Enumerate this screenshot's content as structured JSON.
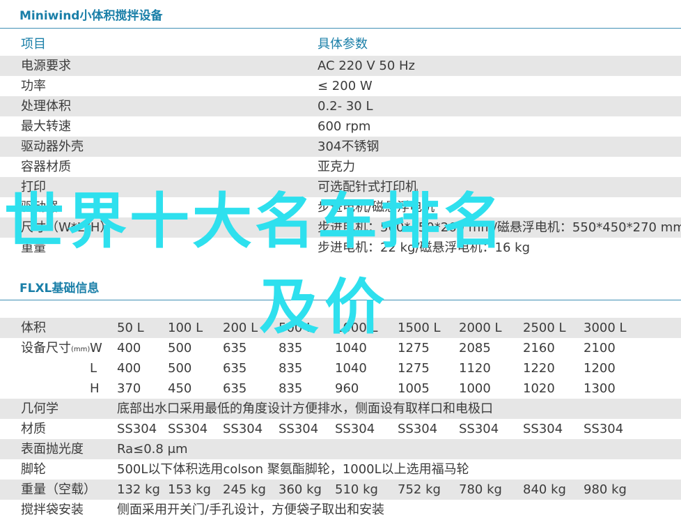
{
  "section1": {
    "title": "Miniwind小体积搅拌设备",
    "header": {
      "item": "项目",
      "param": "具体参数"
    },
    "rows": [
      {
        "item": "电源要求",
        "value": "AC 220 V 50 Hz"
      },
      {
        "item": "功率",
        "value": "≤ 200 W"
      },
      {
        "item": "处理体积",
        "value": "0.2- 30 L"
      },
      {
        "item": "最大转速",
        "value": "600 rpm"
      },
      {
        "item": "驱动器外壳",
        "value": "304不锈钢"
      },
      {
        "item": "容器材质",
        "value": "亚克力"
      },
      {
        "item": "打印",
        "value": "可选配针式打印机"
      },
      {
        "item": "驱动器",
        "value": "步进电机/磁悬浮电机"
      },
      {
        "item": "尺寸（W*L*H）",
        "value": "步进电机：560*450*260 mm/磁悬浮电机：550*450*270 mm"
      },
      {
        "item": "重量",
        "value": "步进电机：22 kg/磁悬浮电机：16 kg"
      }
    ]
  },
  "section2": {
    "title": "FLXL基础信息",
    "rows": [
      {
        "label": "体积",
        "values": [
          "50 L",
          "100 L",
          "200 L",
          "500 L",
          "1000 L",
          "1500 L",
          "2000 L",
          "2500 L",
          "3000 L"
        ]
      },
      {
        "label": "设备尺寸",
        "unit": "(mm)",
        "axis": "W",
        "values": [
          "400",
          "500",
          "635",
          "835",
          "1040",
          "1275",
          "2085",
          "2160",
          "2100"
        ]
      },
      {
        "axis": "L",
        "values": [
          "400",
          "500",
          "635",
          "835",
          "1040",
          "1275",
          "1120",
          "1220",
          "1200"
        ]
      },
      {
        "axis": "H",
        "values": [
          "370",
          "450",
          "635",
          "835",
          "960",
          "1005",
          "1000",
          "1020",
          "1300"
        ]
      },
      {
        "label": "几何学",
        "text": "底部出水口采用最低的角度设计方便排水，侧面设有取样口和电极口"
      },
      {
        "label": "材质",
        "values": [
          "SS304",
          "SS304",
          "SS304",
          "SS304",
          "SS304",
          "SS304",
          "SS304",
          "SS304",
          "SS304"
        ]
      },
      {
        "label": "表面抛光度",
        "text": "Ra≤0.8 μm"
      },
      {
        "label": "脚轮",
        "text": "500L以下体积选用colson 聚氨酯脚轮，1000L以上选用福马轮"
      },
      {
        "label": "重量（空载）",
        "values": [
          "132 kg",
          "153 kg",
          "245 kg",
          "360 kg",
          "510 kg",
          "752 kg",
          "780 kg",
          "840 kg",
          "980 kg"
        ]
      },
      {
        "label": "搅拌袋安装",
        "text": "侧面采用开关门/手孔设计，方便袋子取出和安装"
      }
    ]
  },
  "overlay": {
    "line1": "世界十大名车排名",
    "line2": "及价"
  }
}
